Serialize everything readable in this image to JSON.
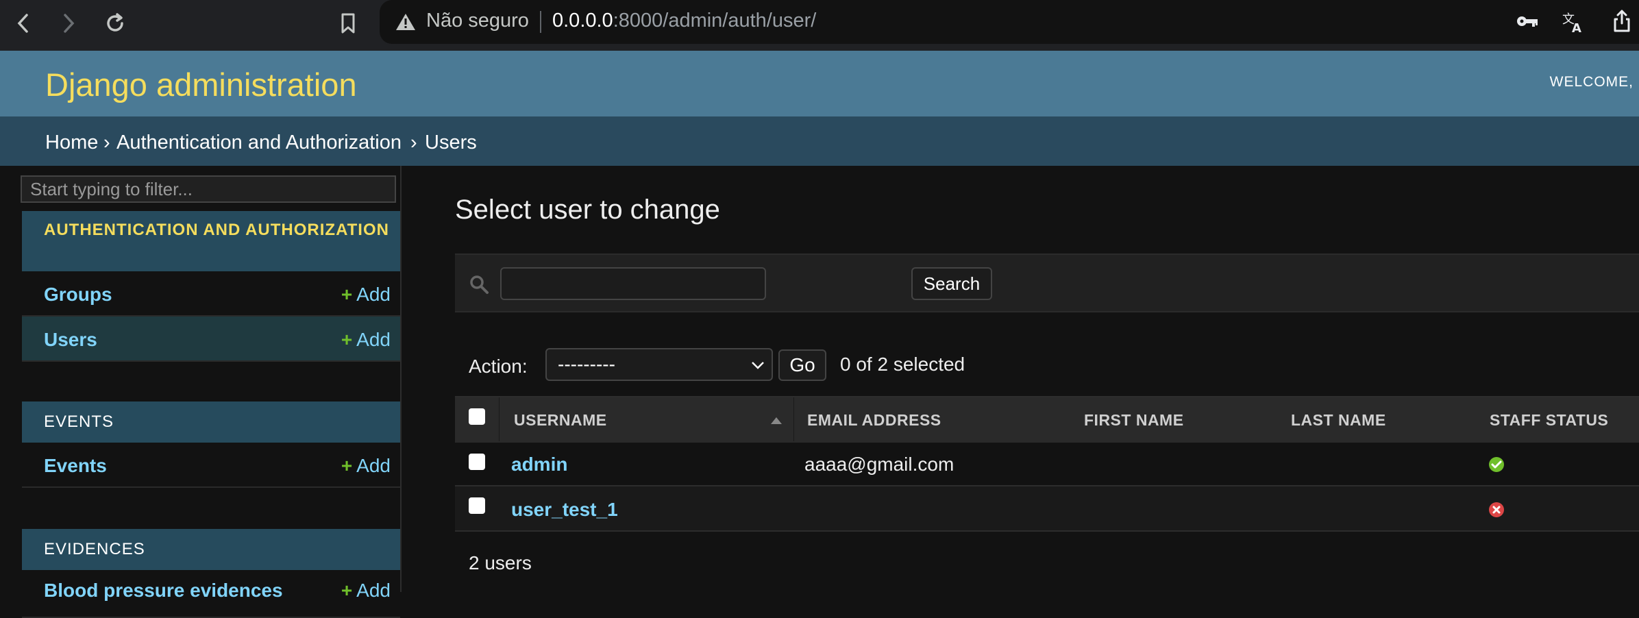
{
  "browser": {
    "security_label": "Não seguro",
    "url_host": "0.0.0.0",
    "url_rest": ":8000/admin/auth/user/"
  },
  "header": {
    "site_name": "Django administration",
    "welcome": "WELCOME,"
  },
  "breadcrumbs": {
    "home": "Home",
    "sep": "›",
    "app": "Authentication and Authorization",
    "current": "Users"
  },
  "sidebar": {
    "filter_placeholder": "Start typing to filter...",
    "add_label": "Add",
    "modules": [
      {
        "title": "AUTHENTICATION AND AUTHORIZATION",
        "items": [
          "Groups",
          "Users"
        ]
      },
      {
        "title": "EVENTS",
        "items": [
          "Events"
        ]
      },
      {
        "title": "EVIDENCES",
        "items": [
          "Blood pressure evidences"
        ]
      }
    ]
  },
  "content": {
    "title": "Select user to change",
    "search_button": "Search",
    "action_label": "Action:",
    "action_value": "---------",
    "go_button": "Go",
    "selected_count": "0 of 2 selected",
    "columns": [
      "USERNAME",
      "EMAIL ADDRESS",
      "FIRST NAME",
      "LAST NAME",
      "STAFF STATUS"
    ],
    "rows": [
      {
        "username": "admin",
        "email": "aaaa@gmail.com",
        "first_name": "",
        "last_name": "",
        "staff": true
      },
      {
        "username": "user_test_1",
        "email": "",
        "first_name": "",
        "last_name": "",
        "staff": false
      }
    ],
    "result_count": "2 users"
  },
  "colors": {
    "header_bg": "#4b7a95",
    "site_name": "#f5dd5d",
    "link": "#81d4fa",
    "add_plus": "#70bf2b",
    "staff_yes": "#70bf2b",
    "staff_no": "#dd4646"
  }
}
